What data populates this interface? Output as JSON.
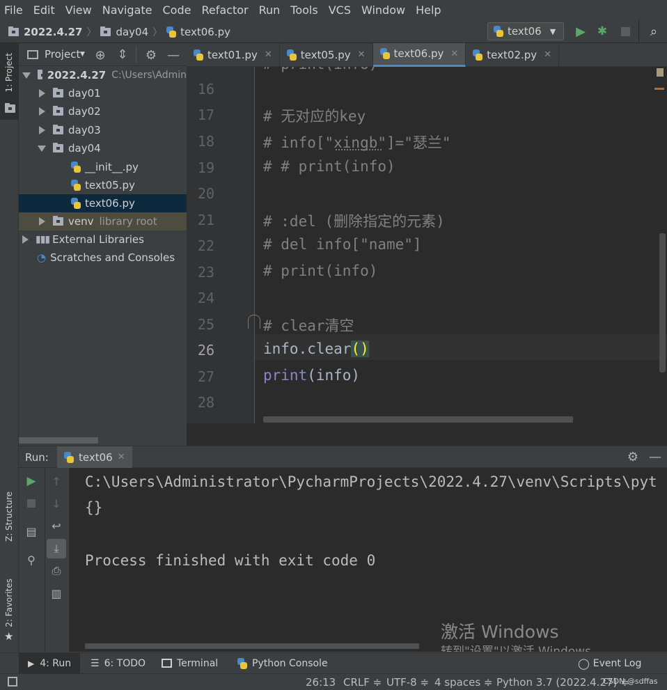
{
  "menu": [
    "File",
    "Edit",
    "View",
    "Navigate",
    "Code",
    "Refactor",
    "Run",
    "Tools",
    "VCS",
    "Window",
    "Help"
  ],
  "breadcrumb": [
    "2022.4.27",
    "day04",
    "text06.py"
  ],
  "run_config": "text06",
  "left_strip": {
    "project": "1: Project",
    "structure": "Z: Structure",
    "favorites": "2: Favorites"
  },
  "project_panel": {
    "title": "Project",
    "root_name": "2022.4.27",
    "root_path": "C:\\Users\\Admin",
    "items": [
      {
        "label": "day01"
      },
      {
        "label": "day02"
      },
      {
        "label": "day03"
      },
      {
        "label": "day04"
      },
      {
        "label": "__init__.py"
      },
      {
        "label": "text05.py"
      },
      {
        "label": "text06.py"
      },
      {
        "label": "venv",
        "suffix": "library root"
      },
      {
        "label": "External Libraries"
      },
      {
        "label": "Scratches and Consoles"
      }
    ]
  },
  "tabs": [
    {
      "label": "text01.py"
    },
    {
      "label": "text05.py"
    },
    {
      "label": "text06.py"
    },
    {
      "label": "text02.py"
    }
  ],
  "editor": {
    "partial_top": "# print(info)",
    "lines": [
      {
        "n": "16",
        "text": ""
      },
      {
        "n": "17",
        "text": "# 无对应的key"
      },
      {
        "n": "18",
        "text": "# info[\"xingb\"]=\"瑟兰\""
      },
      {
        "n": "19",
        "text": "# # print(info)"
      },
      {
        "n": "20",
        "text": ""
      },
      {
        "n": "21",
        "text": "# :del (删除指定的元素)"
      },
      {
        "n": "22",
        "text": "# del info[\"name\"]"
      },
      {
        "n": "23",
        "text": "# print(info)"
      },
      {
        "n": "24",
        "text": ""
      },
      {
        "n": "25",
        "text": "# clear清空"
      },
      {
        "n": "26",
        "text": "info.clear()"
      },
      {
        "n": "27",
        "text": "print(info)"
      },
      {
        "n": "28",
        "text": ""
      }
    ],
    "line26": {
      "obj": "info.clear",
      "paren": "()"
    },
    "line27": {
      "fn": "print",
      "rest": "(info)"
    }
  },
  "run": {
    "label": "Run:",
    "tab": "text06",
    "output": [
      "C:\\Users\\Administrator\\PycharmProjects\\2022.4.27\\venv\\Scripts\\pyt",
      "{}",
      "",
      "Process finished with exit code 0"
    ]
  },
  "watermark": {
    "line1": "激活 Windows",
    "line2": "转到\"设置\"以激活 Windows。"
  },
  "bottom_tools": [
    {
      "label": "4: Run"
    },
    {
      "label": "6: TODO"
    },
    {
      "label": "Terminal"
    },
    {
      "label": "Python Console"
    }
  ],
  "event_log": "Event Log",
  "status": {
    "position": "26:13",
    "line_sep": "CRLF ≑",
    "encoding": "UTF-8 ≑",
    "indent": "4 spaces ≑",
    "interpreter": "Python 3.7 (2022.4.27) ≑",
    "credit": "CSDN @sdffas"
  }
}
